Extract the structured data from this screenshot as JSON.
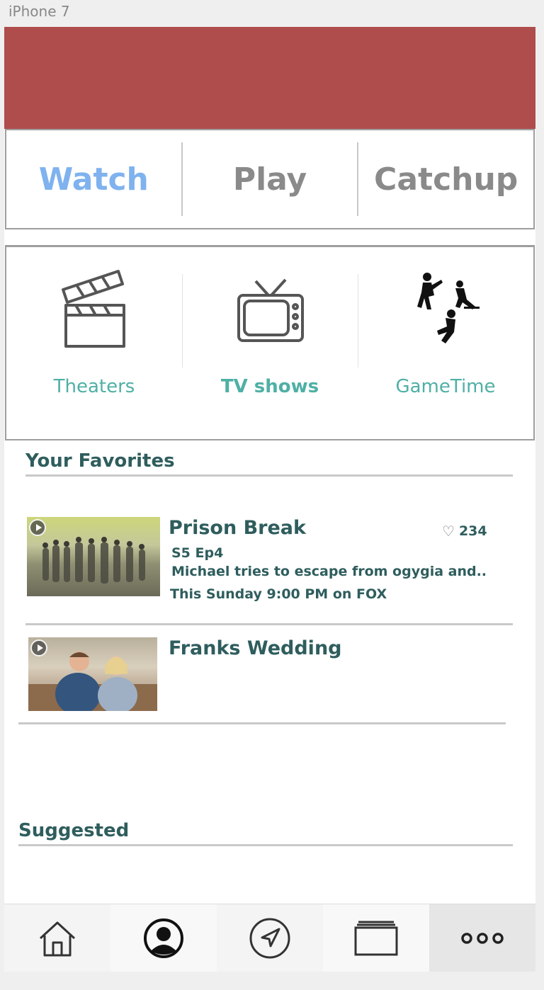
{
  "device": {
    "label": "iPhone 7"
  },
  "tabs": [
    {
      "label": "Watch",
      "active": true
    },
    {
      "label": "Play",
      "active": false
    },
    {
      "label": "Catchup",
      "active": false
    }
  ],
  "categories": [
    {
      "label": "Theaters",
      "icon": "clapperboard-icon"
    },
    {
      "label": "TV shows",
      "icon": "tv-icon"
    },
    {
      "label": "GameTime",
      "icon": "sports-players-icon"
    }
  ],
  "favorites": {
    "title": "Your Favorites",
    "items": [
      {
        "title": "Prison Break",
        "likes": "234",
        "episode": "S5 Ep4",
        "description": "Michael tries to escape from ogygia and..",
        "airtime": "This Sunday 9:00 PM on FOX"
      },
      {
        "title": "Franks Wedding"
      }
    ]
  },
  "suggested": {
    "title": "Suggested"
  },
  "bottom_nav": [
    {
      "name": "home-icon"
    },
    {
      "name": "profile-icon"
    },
    {
      "name": "navigate-icon"
    },
    {
      "name": "screens-icon"
    },
    {
      "name": "more-icon"
    }
  ],
  "colors": {
    "header": "#af4c4c",
    "active_tab": "#7fb2ee",
    "inactive_tab": "#8a8a8a",
    "category_text": "#4fb0a5",
    "heading_text": "#2f5d5d"
  }
}
